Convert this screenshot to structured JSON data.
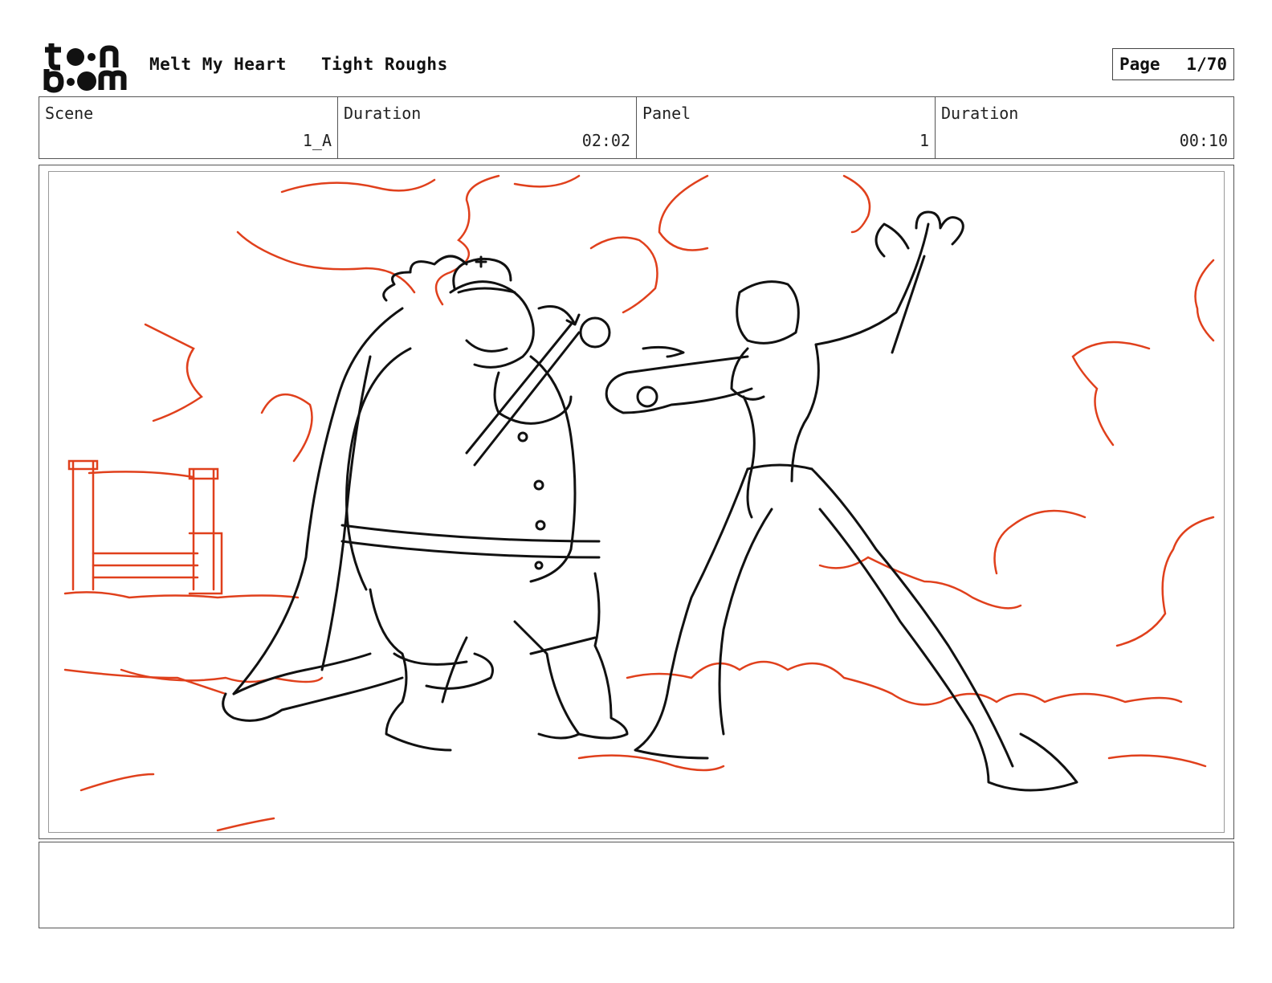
{
  "header": {
    "logo_text": "toonboom",
    "project_title": "Melt My Heart",
    "sequence_title": "Tight Roughs",
    "page_label": "Page",
    "page_number": "1/70"
  },
  "info": {
    "scene_label": "Scene",
    "scene_value": "1_A",
    "scene_duration_label": "Duration",
    "scene_duration_value": "02:02",
    "panel_label": "Panel",
    "panel_value": "1",
    "panel_duration_label": "Duration",
    "panel_duration_value": "00:10"
  },
  "notes": {
    "text": ""
  },
  "colors": {
    "sketch_red": "#e0401c",
    "ink": "#111111",
    "frame": "#555555"
  }
}
